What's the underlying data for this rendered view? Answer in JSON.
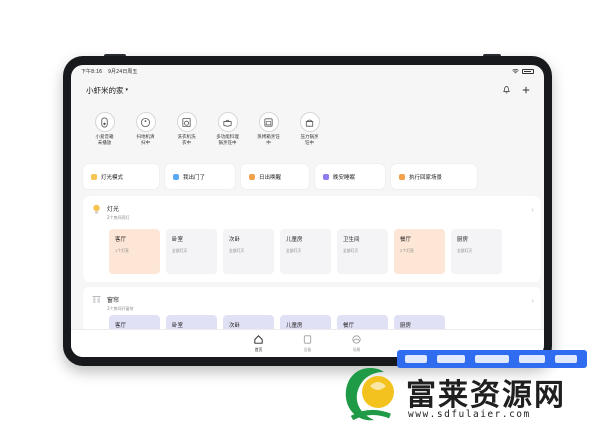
{
  "status_bar": {
    "time": "下午8:16",
    "date": "9月24日周五"
  },
  "header": {
    "home_name": "小虾米的家",
    "caret": "▾"
  },
  "devices": [
    {
      "name": "小爱音箱\n未播放",
      "icon": "speaker-icon"
    },
    {
      "name": "扫地机清\n扫中",
      "icon": "robot-vacuum-icon"
    },
    {
      "name": "洗衣机洗\n衣中",
      "icon": "washer-icon"
    },
    {
      "name": "多功能料理\n锅烹饪中",
      "icon": "cooker-icon"
    },
    {
      "name": "蒸烤箱烹饪\n中",
      "icon": "oven-icon"
    },
    {
      "name": "压力锅烹\n饪中",
      "icon": "pressure-cooker-icon"
    }
  ],
  "scenes": [
    {
      "label": "灯光模式",
      "color": "#f6c452"
    },
    {
      "label": "我出门了",
      "color": "#5aa9f0"
    },
    {
      "label": "日出唤醒",
      "color": "#f2a24a"
    },
    {
      "label": "晚安睡眠",
      "color": "#8e7cf0"
    },
    {
      "label": "执行回家场景",
      "color": "#f2a24a"
    }
  ],
  "lights": {
    "title": "灯光",
    "subtitle": "2个房间亮灯",
    "rooms": [
      {
        "name": "客厅",
        "sub": "1个灯亮",
        "on": true
      },
      {
        "name": "卧室",
        "sub": "全部灯灭",
        "on": false
      },
      {
        "name": "次卧",
        "sub": "全部灯灭",
        "on": false
      },
      {
        "name": "儿童房",
        "sub": "全部灯灭",
        "on": false
      },
      {
        "name": "卫生间",
        "sub": "全部灯灭",
        "on": false
      },
      {
        "name": "餐厅",
        "sub": "2个灯亮",
        "on": true
      },
      {
        "name": "厨房",
        "sub": "全部灯灭",
        "on": false
      }
    ]
  },
  "curtains": {
    "title": "窗帘",
    "subtitle": "3个房间开窗帘",
    "rooms": [
      {
        "name": "客厅"
      },
      {
        "name": "卧室"
      },
      {
        "name": "次卧"
      },
      {
        "name": "儿童房"
      },
      {
        "name": "餐厅"
      },
      {
        "name": "厨房"
      }
    ]
  },
  "tabs": [
    {
      "label": "首页",
      "icon": "home-icon",
      "active": true
    },
    {
      "label": "设备",
      "icon": "devices-icon",
      "active": false
    },
    {
      "label": "场景",
      "icon": "scene-icon",
      "active": false
    }
  ],
  "watermark": {
    "title": "富莱资源网",
    "url": "www.sdfulaier.com"
  },
  "colors": {
    "accent_orange": "#fde6d6",
    "curtain_purple": "#e1e1f6",
    "background": "#f6f6f7"
  }
}
